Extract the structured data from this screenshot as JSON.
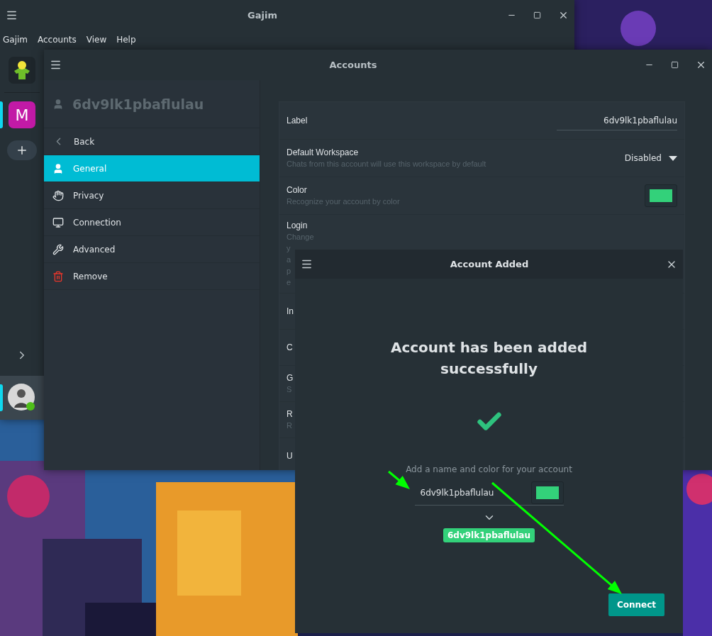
{
  "main_window": {
    "title": "Gajim",
    "menu": [
      "Gajim",
      "Accounts",
      "View",
      "Help"
    ],
    "workspaces": [
      {
        "letter": "M",
        "color": "#c21aa6",
        "selected": true
      }
    ],
    "account": {
      "online": true,
      "selected": true
    }
  },
  "accounts_window": {
    "title": "Accounts",
    "account_name": "6dv9lk1pbaflulau",
    "nav": [
      {
        "kind": "back",
        "label": "Back",
        "selected": false
      },
      {
        "kind": "general",
        "label": "General",
        "selected": true
      },
      {
        "kind": "privacy",
        "label": "Privacy",
        "selected": false
      },
      {
        "kind": "connection",
        "label": "Connection",
        "selected": false
      },
      {
        "kind": "advanced",
        "label": "Advanced",
        "selected": false
      },
      {
        "kind": "remove",
        "label": "Remove",
        "selected": false
      }
    ],
    "settings": [
      {
        "kind": "entry",
        "title": "Label",
        "value": "6dv9lk1pbaflulau"
      },
      {
        "kind": "dropdown",
        "title": "Default Workspace",
        "subtitle": "Chats from this account will use this workspace by default",
        "value": "Disabled"
      },
      {
        "kind": "color",
        "title": "Color",
        "subtitle": "Recognize your account by color",
        "color": "#33d17a"
      },
      {
        "kind": "plain",
        "title": "Login",
        "subtitle_lines": [
          "Change",
          "y",
          "a",
          "p",
          "e"
        ]
      },
      {
        "kind": "plain",
        "title": "In"
      },
      {
        "kind": "plain",
        "title": "C"
      },
      {
        "kind": "plain",
        "title": "G",
        "subtitle_lines": [
          "S"
        ]
      },
      {
        "kind": "plain",
        "title": "R",
        "subtitle_lines": [
          "R"
        ]
      },
      {
        "kind": "plain",
        "title": "U"
      }
    ]
  },
  "dialog": {
    "title": "Account Added",
    "heading": "Account has been added successfully",
    "caption": "Add a name and color for your account",
    "name_value": "6dv9lk1pbaflulau",
    "color": "#33d17a",
    "badge": "6dv9lk1pbaflulau",
    "button": "Connect"
  }
}
